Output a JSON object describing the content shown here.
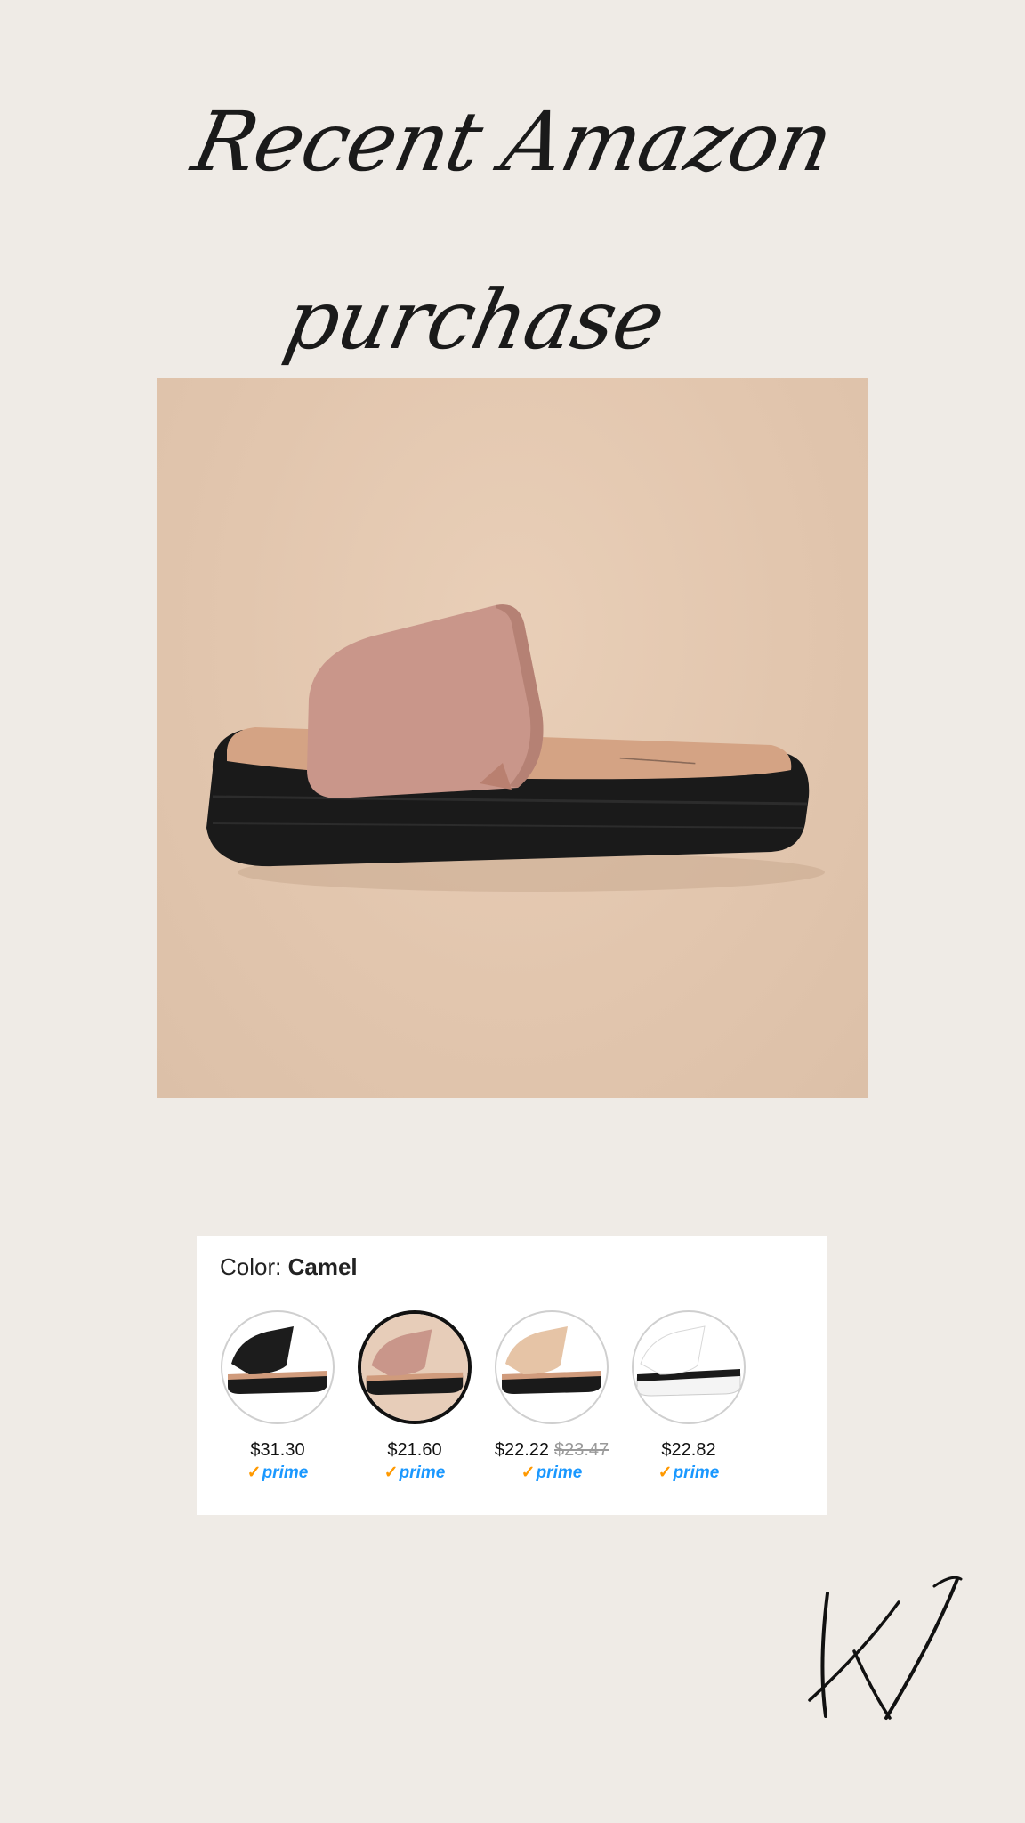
{
  "title": "Recent Amazon purchase",
  "product": {
    "color_label": "Color:",
    "color_value": "Camel",
    "variants": [
      {
        "price": "$31.30",
        "old_price": "",
        "prime": "prime",
        "color": "Black",
        "selected": false
      },
      {
        "price": "$21.60",
        "old_price": "",
        "prime": "prime",
        "color": "Camel",
        "selected": true
      },
      {
        "price": "$22.22",
        "old_price": "$23.47",
        "prime": "prime",
        "color": "Nude",
        "selected": false
      },
      {
        "price": "$22.82",
        "old_price": "",
        "prime": "prime",
        "color": "White",
        "selected": false
      }
    ]
  },
  "signature": "KV",
  "colors": {
    "background": "#efebe6",
    "hero_background": "#e2c6ae",
    "strap_camel": "#c9968a",
    "sole_black": "#1a1a1a",
    "prime_blue": "#1a98ff",
    "prime_check": "#ff9900"
  }
}
